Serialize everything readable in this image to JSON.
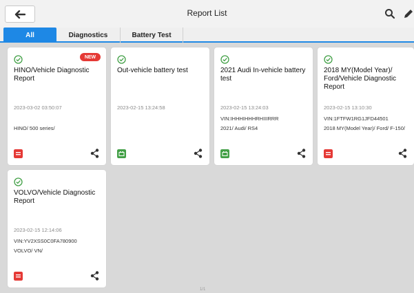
{
  "header": {
    "title": "Report List"
  },
  "tabs": [
    {
      "label": "All",
      "active": true
    },
    {
      "label": "Diagnostics",
      "active": false
    },
    {
      "label": "Battery Test",
      "active": false
    }
  ],
  "reports": [
    {
      "icon": "check-circle-icon",
      "title": "HINO/Vehicle Diagnostic Report",
      "badge": "NEW",
      "date": "2023-03-02 03:50:07",
      "vin": "",
      "detail": "HINO/ 500 series/",
      "report_type": "diagnostic",
      "type_color": "#e53935"
    },
    {
      "icon": "check-circle-icon",
      "title": "Out-vehicle battery test",
      "badge": "",
      "date": "2023-02-15 13:24:58",
      "vin": "",
      "detail": "",
      "report_type": "battery",
      "type_color": "#43a047"
    },
    {
      "icon": "check-circle-icon",
      "title": "2021 Audi In-vehicle battery test",
      "badge": "",
      "date": "2023-02-15 13:24:03",
      "vin": "VIN:IHHHIHHHRHIIIRRR",
      "detail": "2021/ Audi/ RS4",
      "report_type": "battery",
      "type_color": "#43a047"
    },
    {
      "icon": "check-circle-icon",
      "title": "2018 MY(Model Year)/ Ford/Vehicle Diagnostic Report",
      "badge": "",
      "date": "2023-02-15 13:10:30",
      "vin": "VIN:1FTFW1RG1JFD44501",
      "detail": "2018 MY(Model Year)/ Ford/ F-150/",
      "report_type": "diagnostic",
      "type_color": "#e53935"
    },
    {
      "icon": "check-circle-icon",
      "title": "VOLVO/Vehicle Diagnostic Report",
      "badge": "",
      "date": "2023-02-15 12:14:06",
      "vin": "VIN:YV2XSS0C0FA780900",
      "detail": "VOLVO/ VN/",
      "report_type": "diagnostic",
      "type_color": "#e53935"
    }
  ],
  "pager": {
    "text": "1/1"
  },
  "colors": {
    "accent": "#1e88e5",
    "success": "#43a047",
    "danger": "#e53935"
  }
}
